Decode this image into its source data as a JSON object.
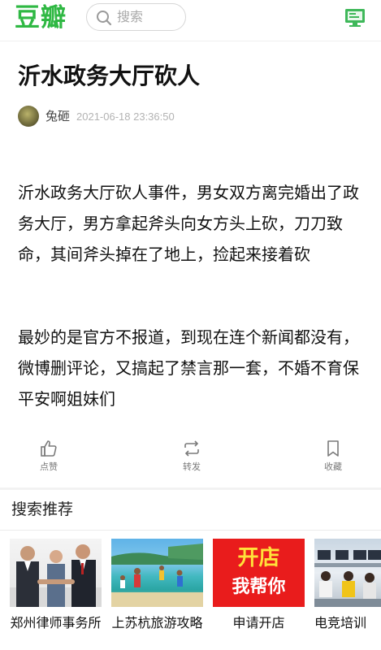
{
  "header": {
    "logo_text": "豆瓣",
    "search_placeholder": "搜索",
    "search_icon": "search-icon",
    "app_icon": "monitor-icon"
  },
  "article": {
    "title": "沂水政务大厅砍人",
    "author": "兔砸",
    "timestamp": "2021-06-18 23:36:50",
    "paragraphs": [
      "沂水政务大厅砍人事件，男女双方离完婚出了政务大厅，男方拿起斧头向女方头上砍，刀刀致命，其间斧头掉在了地上，捡起来接着砍",
      "最妙的是官方不报道，到现在连个新闻都没有，微博删评论，又搞起了禁言那一套，不婚不育保平安啊姐妹们"
    ]
  },
  "actions": {
    "like_label": "点赞",
    "share_label": "转发",
    "favorite_label": "收藏"
  },
  "recommend": {
    "title": "搜索推荐",
    "items": [
      {
        "caption": "郑州律师事务所",
        "image": "business-people-photo"
      },
      {
        "caption": "上苏杭旅游攻略",
        "image": "beach-tourists-photo"
      },
      {
        "caption": "申请开店",
        "image": "open-store-banner",
        "banner_line1": "开店",
        "banner_line2": "我帮你"
      },
      {
        "caption": "电竞培训",
        "image": "computer-classroom-photo"
      }
    ]
  },
  "colors": {
    "brand_green": "#2fb843",
    "banner_red": "#e91c1c",
    "banner_yellow": "#ffe23a"
  }
}
